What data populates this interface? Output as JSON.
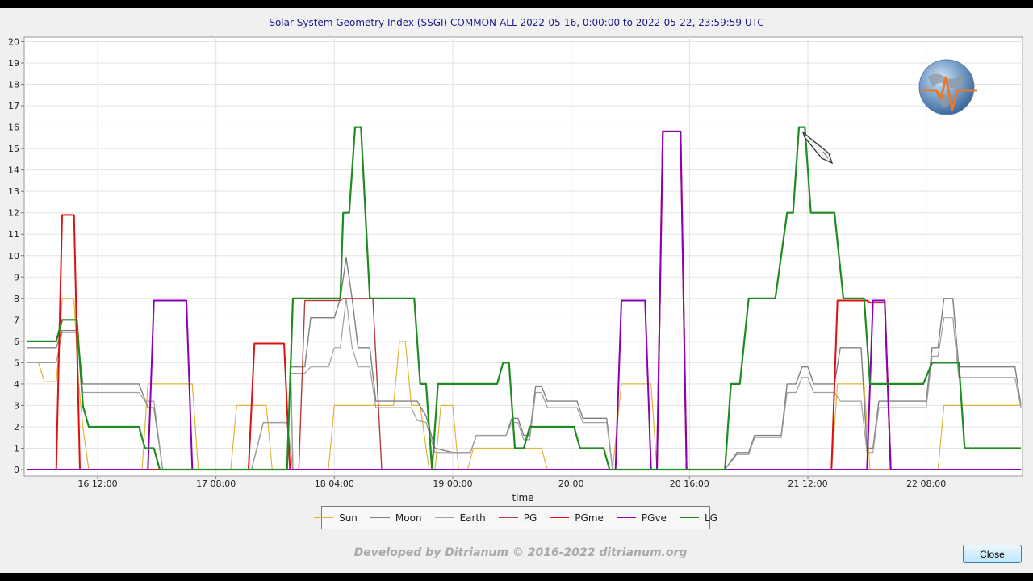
{
  "window": {
    "close_label": "Close",
    "credit": "Developed by Ditrianum © 2016-2022 ditrianum.org"
  },
  "chart_data": {
    "type": "line",
    "title": "Solar System Geometry Index (SSGI) COMMON-ALL 2022-05-16,  0:00:00 to 2022-05-22, 23:59:59 UTC",
    "xlabel": "time",
    "ylabel": "",
    "ylim": [
      0,
      20
    ],
    "xlim": [
      0,
      168
    ],
    "grid": true,
    "legend_position": "bottom",
    "y_ticks": [
      0,
      1,
      2,
      3,
      4,
      5,
      6,
      7,
      8,
      9,
      10,
      11,
      12,
      13,
      14,
      15,
      16,
      17,
      18,
      19,
      20
    ],
    "x_ticks": [
      {
        "t": 12,
        "label": "16 12:00"
      },
      {
        "t": 32,
        "label": "17 08:00"
      },
      {
        "t": 52,
        "label": "18 04:00"
      },
      {
        "t": 72,
        "label": "19 00:00"
      },
      {
        "t": 92,
        "label": "20:00"
      },
      {
        "t": 112,
        "label": "20 16:00"
      },
      {
        "t": 132,
        "label": "21 12:00"
      },
      {
        "t": 152,
        "label": "22 08:00"
      }
    ],
    "x_unit": "hours since 2022-05-16 00:00 UTC",
    "series": [
      {
        "name": "Sun",
        "color": "#e0b43c",
        "points": [
          [
            0,
            5
          ],
          [
            2,
            5
          ],
          [
            3,
            4.1
          ],
          [
            5,
            4.1
          ],
          [
            5.6,
            6
          ],
          [
            6,
            8
          ],
          [
            8,
            8
          ],
          [
            8.8,
            4
          ],
          [
            9.5,
            2
          ],
          [
            10.5,
            0
          ],
          [
            19.5,
            0
          ],
          [
            20.5,
            4
          ],
          [
            28,
            4
          ],
          [
            29,
            0
          ],
          [
            34.5,
            0
          ],
          [
            35.5,
            3
          ],
          [
            40.5,
            3
          ],
          [
            41.5,
            0
          ],
          [
            51,
            0
          ],
          [
            52,
            3
          ],
          [
            62,
            3
          ],
          [
            63,
            6
          ],
          [
            64,
            6
          ],
          [
            65,
            3
          ],
          [
            66.5,
            3
          ],
          [
            67,
            2
          ],
          [
            68,
            0
          ],
          [
            69,
            0
          ],
          [
            70,
            3
          ],
          [
            72,
            3
          ],
          [
            73,
            0
          ],
          [
            74.5,
            0
          ],
          [
            75.5,
            1
          ],
          [
            87,
            1
          ],
          [
            88,
            0
          ],
          [
            99,
            0
          ],
          [
            100.5,
            4
          ],
          [
            105.5,
            4
          ],
          [
            106.5,
            0
          ],
          [
            136,
            0
          ],
          [
            137,
            4
          ],
          [
            141.5,
            4
          ],
          [
            142.5,
            0
          ],
          [
            154,
            0
          ],
          [
            155,
            3
          ],
          [
            168,
            3
          ]
        ]
      },
      {
        "name": "Moon",
        "color": "#808080",
        "points": [
          [
            0,
            5.7
          ],
          [
            5,
            5.7
          ],
          [
            6,
            6.5
          ],
          [
            8.5,
            6.5
          ],
          [
            9.5,
            4
          ],
          [
            19,
            4
          ],
          [
            20.5,
            2.9
          ],
          [
            21.5,
            2.9
          ],
          [
            23,
            0
          ],
          [
            38,
            0
          ],
          [
            40,
            2.2
          ],
          [
            44,
            2.2
          ],
          [
            45,
            0
          ],
          [
            44.6,
            4.8
          ],
          [
            47,
            4.8
          ],
          [
            48,
            7.1
          ],
          [
            52,
            7.1
          ],
          [
            53,
            8
          ],
          [
            54,
            9.9
          ],
          [
            55,
            8
          ],
          [
            56,
            5.7
          ],
          [
            58,
            5.7
          ],
          [
            59,
            3.2
          ],
          [
            66,
            3.2
          ],
          [
            67.5,
            2.5
          ],
          [
            69,
            1
          ],
          [
            72,
            0.8
          ],
          [
            75,
            0.8
          ],
          [
            76,
            1.6
          ],
          [
            81,
            1.6
          ],
          [
            82,
            2.4
          ],
          [
            83,
            2.4
          ],
          [
            84,
            1.6
          ],
          [
            85,
            1.6
          ],
          [
            86,
            3.9
          ],
          [
            87,
            3.9
          ],
          [
            88,
            3.2
          ],
          [
            93,
            3.2
          ],
          [
            94,
            2.4
          ],
          [
            98,
            2.4
          ],
          [
            99,
            0
          ],
          [
            118,
            0
          ],
          [
            120,
            0.8
          ],
          [
            122,
            0.8
          ],
          [
            123,
            1.6
          ],
          [
            127.5,
            1.6
          ],
          [
            128.5,
            4
          ],
          [
            130,
            4
          ],
          [
            131,
            4.8
          ],
          [
            132,
            4.8
          ],
          [
            133,
            4
          ],
          [
            136.5,
            4
          ],
          [
            137.5,
            5.7
          ],
          [
            141,
            5.7
          ],
          [
            142,
            1
          ],
          [
            143,
            1
          ],
          [
            144,
            3.2
          ],
          [
            152,
            3.2
          ],
          [
            153,
            5.7
          ],
          [
            154,
            5.7
          ],
          [
            155,
            8
          ],
          [
            156.5,
            8
          ],
          [
            157.5,
            4.8
          ],
          [
            167,
            4.8
          ],
          [
            168,
            3
          ]
        ]
      },
      {
        "name": "Earth",
        "color": "#a0a0a0",
        "points": [
          [
            0,
            5
          ],
          [
            5,
            5
          ],
          [
            6,
            6.4
          ],
          [
            8.5,
            6.4
          ],
          [
            9.5,
            3.6
          ],
          [
            19,
            3.6
          ],
          [
            20,
            3.2
          ],
          [
            21.5,
            3.2
          ],
          [
            23,
            0
          ],
          [
            38,
            0
          ],
          [
            40,
            2.2
          ],
          [
            44,
            2.2
          ],
          [
            45,
            0
          ],
          [
            44.6,
            4.5
          ],
          [
            47,
            4.5
          ],
          [
            48,
            4.8
          ],
          [
            51,
            4.8
          ],
          [
            52,
            5.7
          ],
          [
            53,
            5.7
          ],
          [
            54,
            8
          ],
          [
            55,
            5.7
          ],
          [
            56,
            4.8
          ],
          [
            58,
            4.8
          ],
          [
            59,
            2.9
          ],
          [
            65,
            2.9
          ],
          [
            66,
            2.3
          ],
          [
            67.5,
            2.2
          ],
          [
            69,
            0.8
          ],
          [
            72,
            0.8
          ],
          [
            75,
            0.8
          ],
          [
            76,
            1.6
          ],
          [
            81,
            1.6
          ],
          [
            82,
            2.2
          ],
          [
            83,
            2.2
          ],
          [
            84,
            1.4
          ],
          [
            85,
            1.4
          ],
          [
            86,
            3.6
          ],
          [
            87,
            3.6
          ],
          [
            88,
            2.9
          ],
          [
            93,
            2.9
          ],
          [
            94,
            2.2
          ],
          [
            98,
            2.2
          ],
          [
            99,
            0
          ],
          [
            118,
            0
          ],
          [
            120,
            0.7
          ],
          [
            122,
            0.7
          ],
          [
            123,
            1.5
          ],
          [
            127.5,
            1.5
          ],
          [
            128.5,
            3.6
          ],
          [
            130,
            3.6
          ],
          [
            131,
            4.3
          ],
          [
            132,
            4.3
          ],
          [
            133,
            3.6
          ],
          [
            136.5,
            3.6
          ],
          [
            137.5,
            3.2
          ],
          [
            141,
            3.2
          ],
          [
            142,
            0.8
          ],
          [
            143,
            0.8
          ],
          [
            144,
            2.9
          ],
          [
            152,
            2.9
          ],
          [
            153,
            5.3
          ],
          [
            154,
            5.3
          ],
          [
            155,
            7.1
          ],
          [
            156.5,
            7.1
          ],
          [
            157.5,
            4.3
          ],
          [
            167,
            4.3
          ],
          [
            168,
            2.9
          ]
        ]
      },
      {
        "name": "PG",
        "color": "#b43c3c",
        "points": [
          [
            0,
            0
          ],
          [
            46,
            0
          ],
          [
            47,
            7.9
          ],
          [
            53,
            7.9
          ],
          [
            53.5,
            8
          ],
          [
            58.5,
            8
          ],
          [
            60,
            0
          ],
          [
            168,
            0
          ]
        ]
      },
      {
        "name": "PGme",
        "color": "#dd1111",
        "points": [
          [
            0,
            0
          ],
          [
            5,
            0
          ],
          [
            6,
            11.9
          ],
          [
            8,
            11.9
          ],
          [
            9,
            0
          ],
          [
            37.5,
            0
          ],
          [
            38.5,
            5.9
          ],
          [
            43.5,
            5.9
          ],
          [
            44.5,
            0
          ],
          [
            106.5,
            0
          ],
          [
            107.5,
            15.8
          ],
          [
            110.5,
            15.8
          ],
          [
            111.5,
            0
          ],
          [
            136,
            0
          ],
          [
            137,
            7.9
          ],
          [
            142,
            7.9
          ],
          [
            142.5,
            7.8
          ],
          [
            145,
            7.8
          ],
          [
            146,
            0
          ],
          [
            168,
            0
          ]
        ]
      },
      {
        "name": "PGve",
        "color": "#8b00b4",
        "points": [
          [
            0,
            0
          ],
          [
            20.5,
            0
          ],
          [
            21.5,
            7.9
          ],
          [
            27,
            7.9
          ],
          [
            28,
            0
          ],
          [
            99.5,
            0
          ],
          [
            100.5,
            7.9
          ],
          [
            104.5,
            7.9
          ],
          [
            105.5,
            0
          ],
          [
            106.5,
            0
          ],
          [
            107.5,
            15.8
          ],
          [
            110.5,
            15.8
          ],
          [
            111.5,
            0
          ],
          [
            142,
            0
          ],
          [
            143,
            7.9
          ],
          [
            145,
            7.9
          ],
          [
            146,
            0
          ],
          [
            168,
            0
          ]
        ]
      },
      {
        "name": "LG",
        "color": "#1e8c1e",
        "points": [
          [
            0,
            6
          ],
          [
            5,
            6
          ],
          [
            6,
            7
          ],
          [
            8.5,
            7
          ],
          [
            9.5,
            3
          ],
          [
            10.5,
            2
          ],
          [
            19,
            2
          ],
          [
            20,
            1
          ],
          [
            21.5,
            1
          ],
          [
            22.5,
            0
          ],
          [
            44,
            0
          ],
          [
            45,
            8
          ],
          [
            53,
            8
          ],
          [
            53.5,
            12
          ],
          [
            54.5,
            12
          ],
          [
            55.5,
            16
          ],
          [
            56.5,
            16
          ],
          [
            58,
            8
          ],
          [
            65.5,
            8
          ],
          [
            66.5,
            4
          ],
          [
            67.5,
            4
          ],
          [
            68.5,
            0
          ],
          [
            69.5,
            4
          ],
          [
            79.5,
            4
          ],
          [
            80.5,
            5
          ],
          [
            81.5,
            5
          ],
          [
            82.5,
            1
          ],
          [
            84,
            1
          ],
          [
            85,
            2
          ],
          [
            92.5,
            2
          ],
          [
            93.5,
            1
          ],
          [
            97.5,
            1
          ],
          [
            98.5,
            0
          ],
          [
            118,
            0
          ],
          [
            119,
            4
          ],
          [
            120.5,
            4
          ],
          [
            122,
            8
          ],
          [
            126.5,
            8
          ],
          [
            128.5,
            12
          ],
          [
            129.5,
            12
          ],
          [
            130.5,
            16
          ],
          [
            131.5,
            16
          ],
          [
            132.5,
            12
          ],
          [
            136.5,
            12
          ],
          [
            138,
            8
          ],
          [
            141.5,
            8
          ],
          [
            142.5,
            4
          ],
          [
            151.5,
            4
          ],
          [
            153,
            5
          ],
          [
            157.5,
            5
          ],
          [
            158.5,
            1
          ],
          [
            168,
            1
          ]
        ]
      }
    ]
  }
}
